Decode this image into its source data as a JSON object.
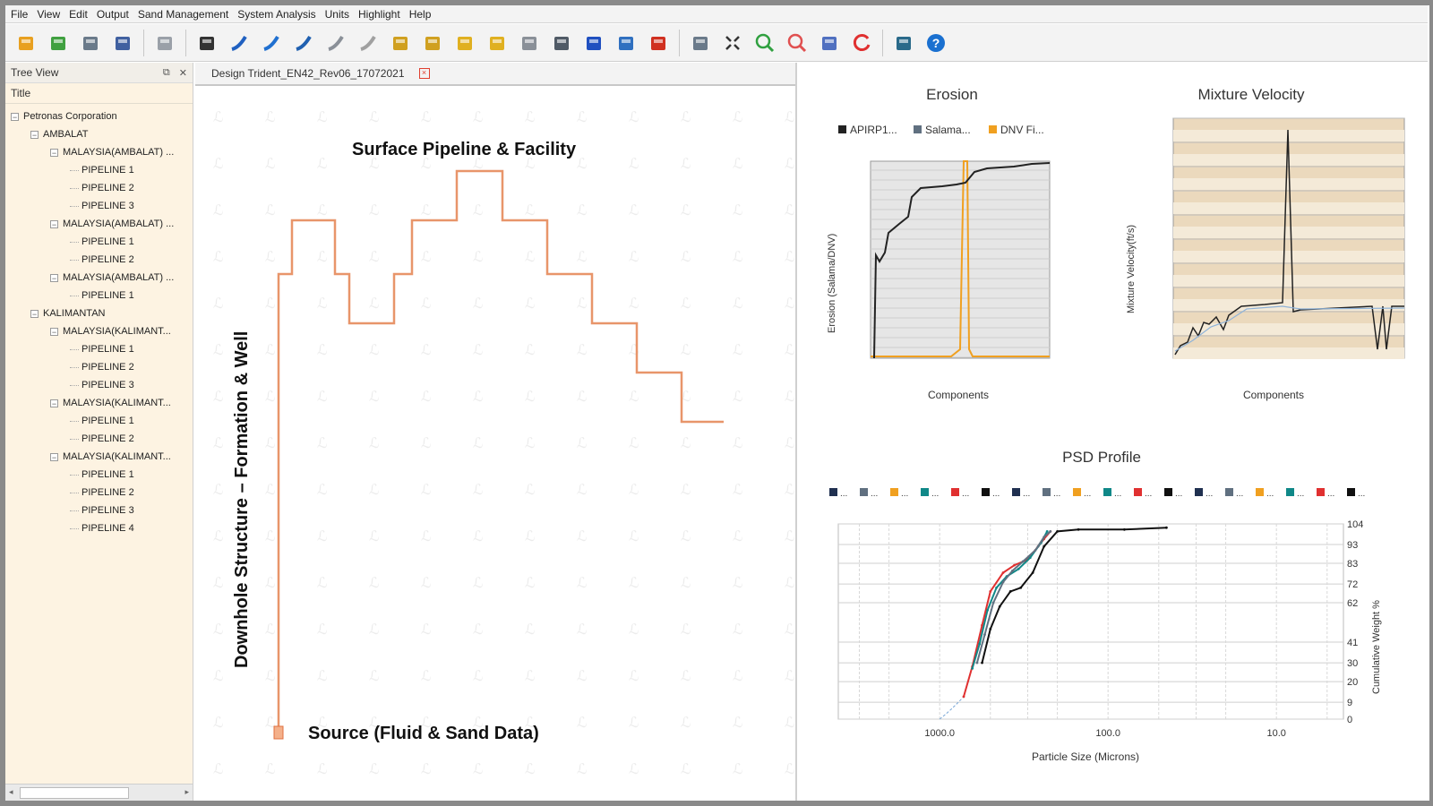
{
  "menu": [
    "File",
    "View",
    "Edit",
    "Output",
    "Sand Management",
    "System Analysis",
    "Units",
    "Highlight",
    "Help"
  ],
  "toolbar_icons": [
    "open-folder-icon",
    "new-project-icon",
    "print-icon",
    "save-icon",
    "import-icon",
    "flow-tool-icon",
    "pipe-horizontal-icon",
    "pipe-bend-icon",
    "pipe-elbow-icon",
    "pipe-slant-icon",
    "pipe-curve-icon",
    "manifold-icon",
    "tee-icon",
    "valve-icon",
    "fitting-icon",
    "separator-icon",
    "choke-icon",
    "wellhead-icon",
    "sensor-icon",
    "alarm-icon",
    "screen-capture-icon",
    "fit-icon",
    "zoom-in-icon",
    "zoom-out-icon",
    "layers-icon",
    "refresh-icon",
    "report-icon",
    "help-icon"
  ],
  "tree": {
    "title": "Tree View",
    "column": "Title",
    "nodes": [
      {
        "label": "Petronas Corporation",
        "level": 0,
        "expander": "⊟"
      },
      {
        "label": "AMBALAT",
        "level": 1,
        "expander": "⊟"
      },
      {
        "label": "MALAYSIA(AMBALAT) ...",
        "level": 2,
        "expander": "⊟"
      },
      {
        "label": "PIPELINE 1",
        "level": 3,
        "expander": ""
      },
      {
        "label": "PIPELINE 2",
        "level": 3,
        "expander": ""
      },
      {
        "label": "PIPELINE 3",
        "level": 3,
        "expander": ""
      },
      {
        "label": "MALAYSIA(AMBALAT) ...",
        "level": 2,
        "expander": "⊟"
      },
      {
        "label": "PIPELINE 1",
        "level": 3,
        "expander": ""
      },
      {
        "label": "PIPELINE 2",
        "level": 3,
        "expander": ""
      },
      {
        "label": "MALAYSIA(AMBALAT) ...",
        "level": 2,
        "expander": "⊟"
      },
      {
        "label": "PIPELINE 1",
        "level": 3,
        "expander": ""
      },
      {
        "label": "KALIMANTAN",
        "level": 1,
        "expander": "⊟"
      },
      {
        "label": "MALAYSIA(KALIMANT...",
        "level": 2,
        "expander": "⊟"
      },
      {
        "label": "PIPELINE 1",
        "level": 3,
        "expander": ""
      },
      {
        "label": "PIPELINE 2",
        "level": 3,
        "expander": ""
      },
      {
        "label": "PIPELINE 3",
        "level": 3,
        "expander": ""
      },
      {
        "label": "MALAYSIA(KALIMANT...",
        "level": 2,
        "expander": "⊟"
      },
      {
        "label": "PIPELINE 1",
        "level": 3,
        "expander": ""
      },
      {
        "label": "PIPELINE 2",
        "level": 3,
        "expander": ""
      },
      {
        "label": "MALAYSIA(KALIMANT...",
        "level": 2,
        "expander": "⊟"
      },
      {
        "label": "PIPELINE 1",
        "level": 3,
        "expander": ""
      },
      {
        "label": "PIPELINE 2",
        "level": 3,
        "expander": ""
      },
      {
        "label": "PIPELINE 3",
        "level": 3,
        "expander": ""
      },
      {
        "label": "PIPELINE 4",
        "level": 3,
        "expander": ""
      }
    ]
  },
  "design": {
    "tab": "Design Trident_EN42_Rev06_17072021",
    "surface_label": "Surface Pipeline & Facility",
    "downhole_label": "Downhole Structure – Formation & Well",
    "source_label": "Source (Fluid & Sand Data)",
    "pipe_color": "#e8956a"
  },
  "chart_data": [
    {
      "type": "line",
      "title": "Erosion",
      "xlabel": "Components",
      "ylabel": "Erosion (Salama/DNV)",
      "legend": [
        {
          "name": "APIRP1...",
          "color": "#222222"
        },
        {
          "name": "Salama...",
          "color": "#607080"
        },
        {
          "name": "DNV Fi...",
          "color": "#f0a020"
        }
      ],
      "legend_position": "top",
      "grid": true
    },
    {
      "type": "line",
      "title": "Mixture Velocity",
      "xlabel": "Components",
      "ylabel": "Mixture Velocity(ft/s)",
      "grid": true
    },
    {
      "type": "line",
      "title": "PSD Profile",
      "xlabel": "Particle Size (Microns)",
      "ylabel": "Cumulative Weight %",
      "x_scale": "log",
      "x_reversed": true,
      "x_ticks": [
        "1000.0",
        "100.0",
        "10.0"
      ],
      "y_ticks": [
        0,
        9,
        20,
        30,
        41,
        62,
        72,
        83,
        93,
        104
      ],
      "ylim": [
        0,
        104
      ],
      "legend_colors": [
        "#203050",
        "#607080",
        "#f0a020",
        "#108888",
        "#e03030",
        "#101010"
      ],
      "series": [
        {
          "color": "#e03030",
          "x": [
            720,
            640,
            560,
            500,
            420,
            360,
            300,
            260,
            240,
            220
          ],
          "y": [
            12,
            28,
            50,
            68,
            78,
            82,
            85,
            92,
            96,
            100
          ]
        },
        {
          "color": "#108888",
          "x": [
            640,
            580,
            520,
            460,
            400,
            340,
            290,
            250,
            230
          ],
          "y": [
            27,
            40,
            58,
            70,
            76,
            80,
            86,
            94,
            100
          ]
        },
        {
          "color": "#607080",
          "x": [
            600,
            540,
            480,
            420,
            370,
            320,
            270,
            240,
            220
          ],
          "y": [
            30,
            45,
            62,
            73,
            79,
            84,
            90,
            97,
            100
          ]
        },
        {
          "color": "#101010",
          "x": [
            560,
            500,
            440,
            380,
            330,
            280,
            240,
            200,
            150,
            80,
            45
          ],
          "y": [
            30,
            48,
            60,
            68,
            70,
            78,
            92,
            100,
            101,
            101,
            102
          ]
        }
      ]
    }
  ]
}
